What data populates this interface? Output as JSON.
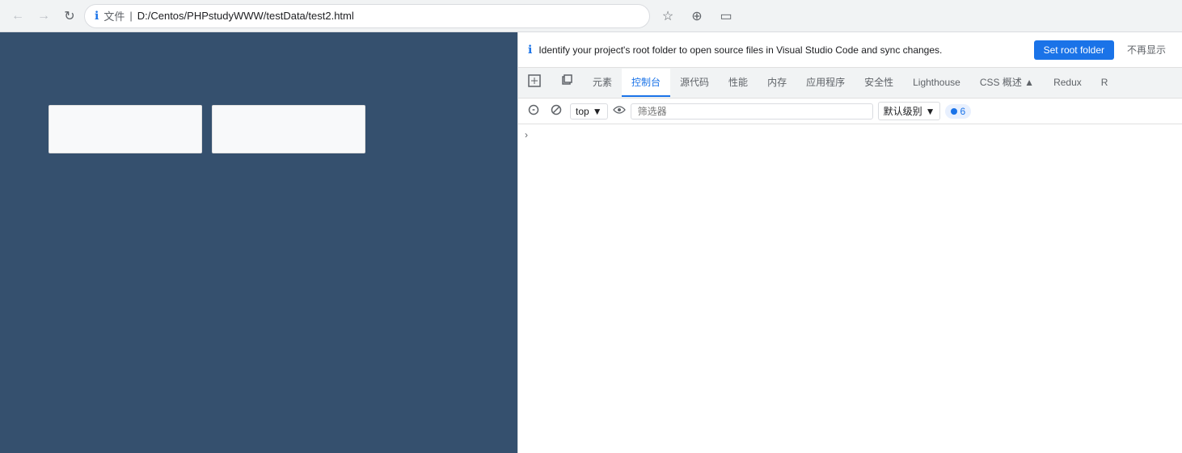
{
  "browser": {
    "back_label": "←",
    "forward_label": "→",
    "reload_label": "↻",
    "file_label": "文件",
    "separator": "|",
    "url": "D:/Centos/PHPstudyWWW/testData/test2.html",
    "star_label": "☆",
    "ext_label": "⊕",
    "menu_label": "▭"
  },
  "banner": {
    "text": "Identify your project's root folder to open source files in Visual Studio Code and sync changes.",
    "set_root_label": "Set root folder",
    "dismiss_label": "不再显示"
  },
  "devtools": {
    "tabs": [
      {
        "id": "inspect",
        "label": "⬛",
        "icon": true
      },
      {
        "id": "copy",
        "label": "⬜",
        "icon": true
      },
      {
        "id": "elements",
        "label": "元素"
      },
      {
        "id": "console",
        "label": "控制台",
        "active": true
      },
      {
        "id": "sources",
        "label": "源代码"
      },
      {
        "id": "performance",
        "label": "性能"
      },
      {
        "id": "memory",
        "label": "内存"
      },
      {
        "id": "application",
        "label": "应用程序"
      },
      {
        "id": "security",
        "label": "安全性"
      },
      {
        "id": "lighthouse",
        "label": "Lighthouse"
      },
      {
        "id": "css-overview",
        "label": "CSS 概述 ▲"
      },
      {
        "id": "redux",
        "label": "Redux"
      },
      {
        "id": "more",
        "label": "R"
      }
    ]
  },
  "toolbar": {
    "block_icon": "⊡",
    "cancel_icon": "⊘",
    "top_selector_label": "top",
    "dropdown_icon": "▼",
    "eye_icon": "👁",
    "filter_placeholder": "筛选器",
    "level_label": "默认级别",
    "level_dropdown": "▼",
    "error_count": "6",
    "arrow_label": "›"
  },
  "page": {
    "boxes": [
      {
        "id": "box1"
      },
      {
        "id": "box2"
      }
    ]
  }
}
